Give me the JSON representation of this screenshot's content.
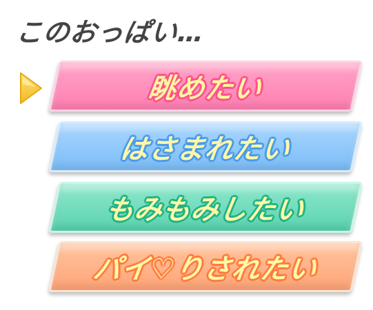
{
  "prompt": {
    "text": "このおっぱい…"
  },
  "cursor": {
    "icon": "triangle-right-icon",
    "color": "#f2c230",
    "selected_index": 0
  },
  "choices": [
    {
      "label": "眺めたい",
      "color": "#ff7fb3",
      "outline": "#ff4f8c"
    },
    {
      "label": "はさまれたい",
      "color": "#7bbdf7",
      "outline": "#4a9be8"
    },
    {
      "label": "もみもみしたい",
      "color": "#59d3ae",
      "outline": "#1fb386"
    },
    {
      "label": "パイ♡りされたい",
      "color": "#ffa477",
      "outline": "#ff7a3d"
    }
  ]
}
